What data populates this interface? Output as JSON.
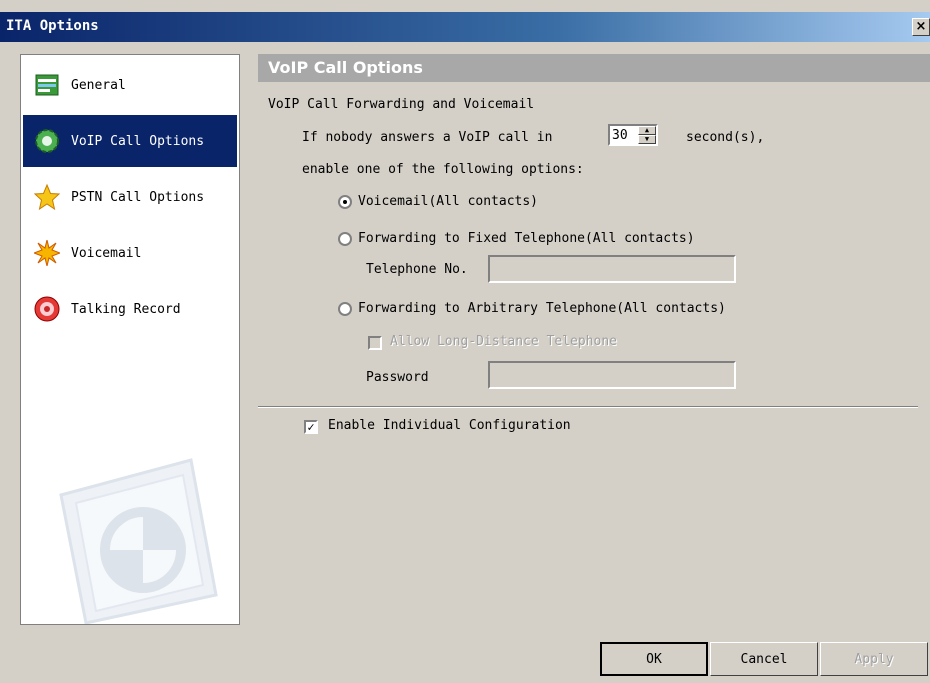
{
  "window": {
    "title": "ITA Options",
    "close_label": "×"
  },
  "sidebar": {
    "items": [
      {
        "label": "General",
        "icon": "general-icon"
      },
      {
        "label": "VoIP Call Options",
        "icon": "gear-icon"
      },
      {
        "label": "PSTN Call Options",
        "icon": "star-icon"
      },
      {
        "label": "Voicemail",
        "icon": "burst-icon"
      },
      {
        "label": "Talking Record",
        "icon": "record-icon"
      }
    ],
    "active_index": 1
  },
  "content": {
    "header": "VoIP Call Options",
    "section_label": "VoIP Call Forwarding and Voicemail",
    "line1_prefix": "If nobody answers a VoIP call in",
    "seconds_value": "30",
    "line1_suffix": "second(s),",
    "line2": "enable one of the following options:",
    "radio_voicemail": "Voicemail(All contacts)",
    "radio_fixed": "Forwarding to Fixed Telephone(All contacts)",
    "telephone_label": "Telephone No.",
    "telephone_value": "",
    "radio_arbitrary": "Forwarding to Arbitrary Telephone(All contacts)",
    "allow_long_distance": "Allow Long-Distance Telephone",
    "password_label": "Password",
    "password_value": "",
    "enable_individual": "Enable Individual Configuration",
    "selected_option": "voicemail",
    "enable_individual_checked": true
  },
  "buttons": {
    "ok": "OK",
    "cancel": "Cancel",
    "apply": "Apply"
  },
  "colors": {
    "title_bar": "#0a246a",
    "selected_item": "#0a246a",
    "header_bg": "#a8a8a8",
    "dialog_bg": "#d4d0c8"
  }
}
